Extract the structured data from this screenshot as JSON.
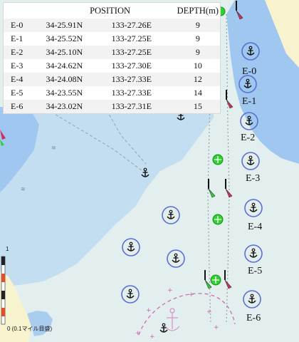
{
  "table": {
    "headers": {
      "id": "",
      "position": "POSITION",
      "depth": "DEPTH(m)"
    },
    "rows": [
      {
        "id": "E-0",
        "lat": "34-25.91N",
        "lon": "133-27.26E",
        "depth": "9"
      },
      {
        "id": "E-1",
        "lat": "34-25.52N",
        "lon": "133-27.25E",
        "depth": "9"
      },
      {
        "id": "E-2",
        "lat": "34-25.10N",
        "lon": "133-27.25E",
        "depth": "9"
      },
      {
        "id": "E-3",
        "lat": "34-24.62N",
        "lon": "133-27.30E",
        "depth": "10"
      },
      {
        "id": "E-4",
        "lat": "34-24.08N",
        "lon": "133-27.33E",
        "depth": "12"
      },
      {
        "id": "E-5",
        "lat": "34-23.55N",
        "lon": "133-27.33E",
        "depth": "14"
      },
      {
        "id": "E-6",
        "lat": "34-23.02N",
        "lon": "133-27.31E",
        "depth": "15"
      }
    ]
  },
  "map": {
    "anchorage_labels": [
      "E-0",
      "E-1",
      "E-2",
      "E-3",
      "E-4",
      "E-5",
      "E-6"
    ],
    "scale_bar_label": "0 (0.1マイル目盛)",
    "scale_bar_tick_label": "1"
  },
  "colors": {
    "land": "#f7f3cf",
    "shallow_water": "#9fc7ef",
    "mid_water": "#c3def0",
    "deep_water": "#e3efee",
    "anchor_ring": "#5b6fd3",
    "buoy_green": "#2ed12e",
    "fairway_line": "#9aa0a6"
  },
  "icons": {
    "anchor": "anchor-icon",
    "buoy": "green-buoy-icon",
    "port_beacon": "lateral-beacon-icon",
    "scale_bar": "scale-bar"
  }
}
